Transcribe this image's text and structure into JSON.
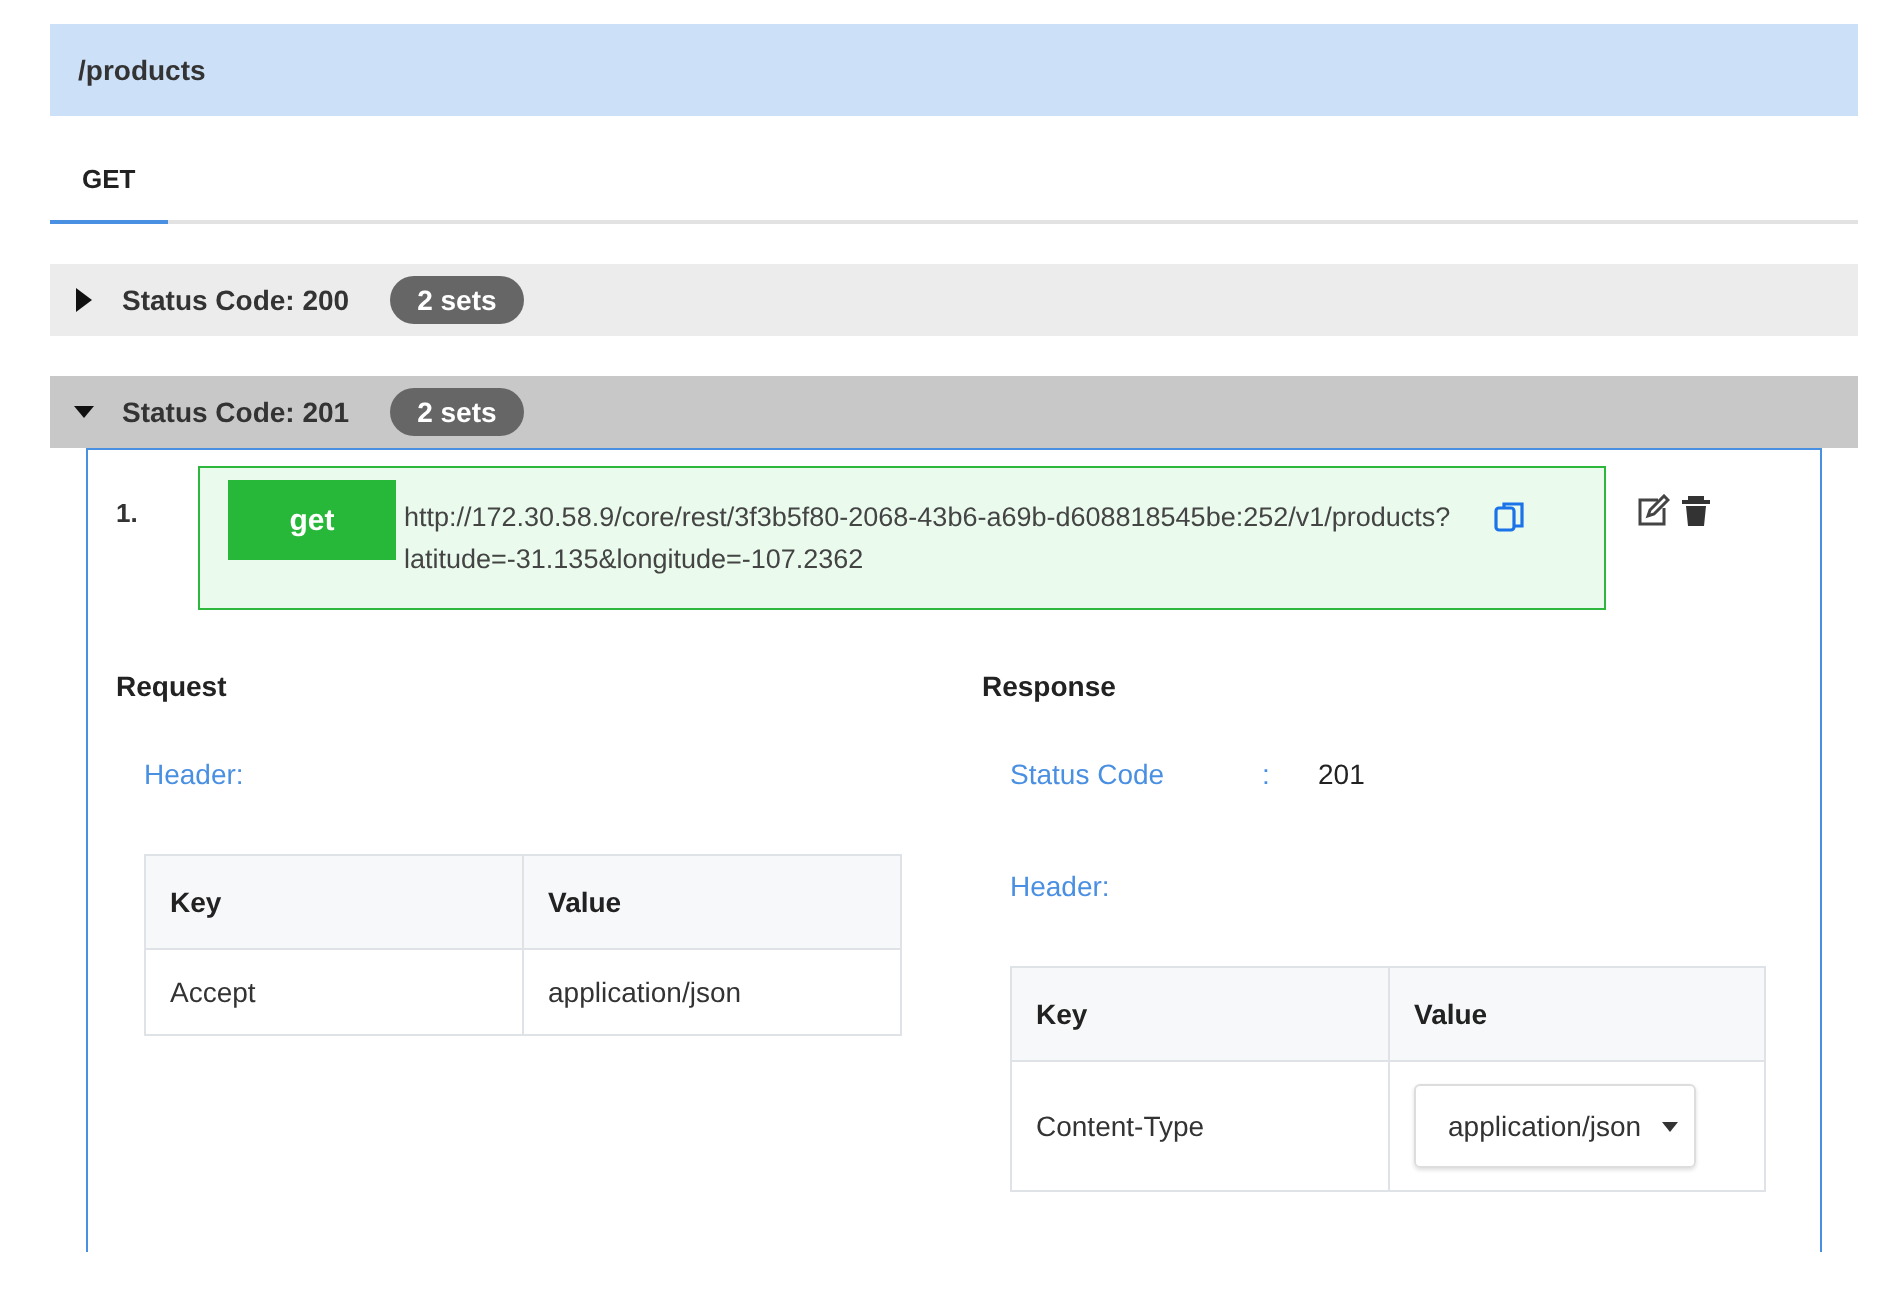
{
  "endpoint": {
    "path": "/products"
  },
  "tabs": [
    {
      "label": "GET",
      "selected": true
    }
  ],
  "status_groups": [
    {
      "label": "Status Code: 200",
      "badge": "2 sets",
      "expanded": false
    },
    {
      "label": "Status Code: 201",
      "badge": "2 sets",
      "expanded": true,
      "sets": [
        {
          "number": "1.",
          "method": "get",
          "url": "http://172.30.58.9/core/rest/3f3b5f80-2068-43b6-a69b-d608818545be:252/v1/products?latitude=-31.135&longitude=-107.2362",
          "request": {
            "title": "Request",
            "header_label": "Header:",
            "columns": [
              "Key",
              "Value"
            ],
            "rows": [
              {
                "key": "Accept",
                "value": "application/json"
              }
            ]
          },
          "response": {
            "title": "Response",
            "status_label": "Status Code",
            "separator": ":",
            "status_value": "201",
            "header_label": "Header:",
            "columns": [
              "Key",
              "Value"
            ],
            "rows": [
              {
                "key": "Content-Type",
                "value": "application/json",
                "kind": "select"
              }
            ]
          }
        }
      ]
    }
  ]
}
